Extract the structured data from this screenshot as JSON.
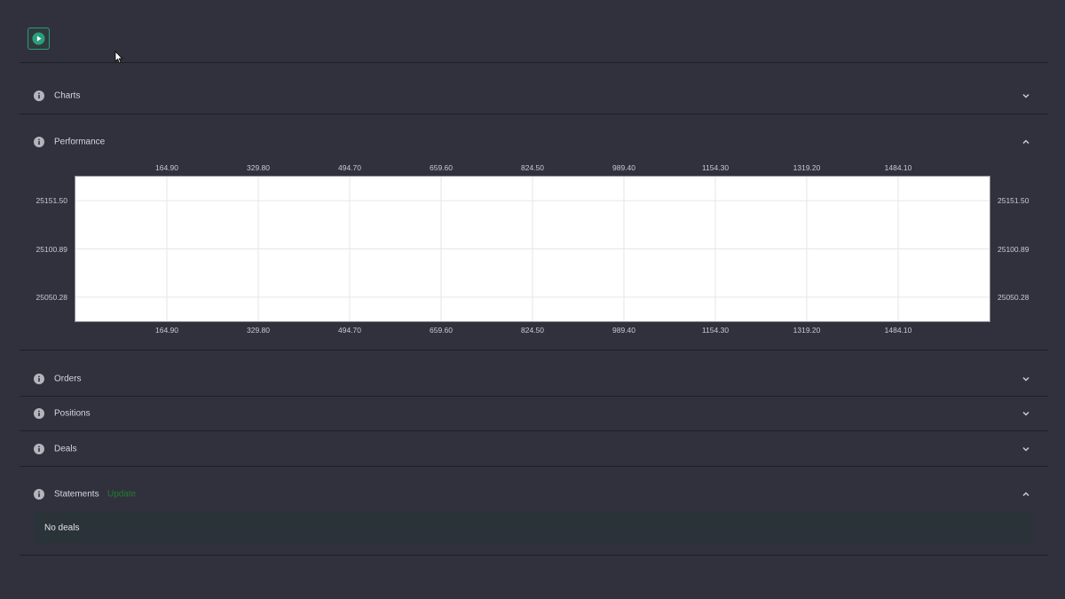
{
  "toolbar": {
    "play_icon": "play-icon"
  },
  "sections": {
    "charts": {
      "title": "Charts",
      "state": "collapsed"
    },
    "performance": {
      "title": "Performance",
      "state": "expanded"
    },
    "orders": {
      "title": "Orders",
      "state": "collapsed"
    },
    "positions": {
      "title": "Positions",
      "state": "collapsed"
    },
    "deals": {
      "title": "Deals",
      "state": "collapsed"
    },
    "statements": {
      "title": "Statements",
      "extra": "Update",
      "state": "expanded",
      "empty_text": "No deals"
    }
  },
  "colors": {
    "background": "#31313d",
    "accent": "#2a9d7e",
    "status_green": "#1e7f2a"
  },
  "chart_data": {
    "type": "line",
    "x_ticks": [
      "164.90",
      "329.80",
      "494.70",
      "659.60",
      "824.50",
      "989.40",
      "1154.30",
      "1319.20",
      "1484.10"
    ],
    "x_tick_values": [
      164.9,
      329.8,
      494.7,
      659.6,
      824.5,
      989.4,
      1154.3,
      1319.2,
      1484.1
    ],
    "y_ticks": [
      "25151.50",
      "25100.89",
      "25050.28"
    ],
    "y_tick_values": [
      25151.5,
      25100.89,
      25050.28
    ],
    "xlim": [
      0,
      1649.0
    ],
    "ylim": [
      25024.97,
      25176.81
    ],
    "grid": true,
    "series": []
  }
}
